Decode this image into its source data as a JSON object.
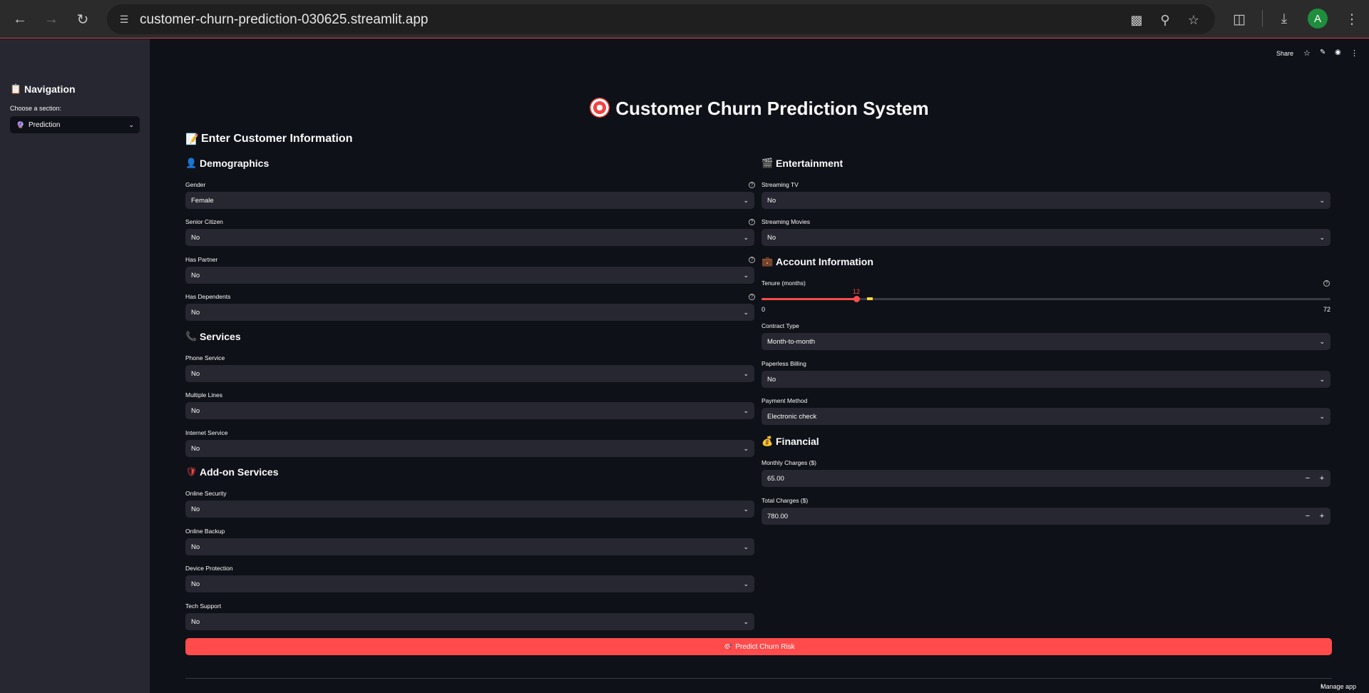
{
  "browser": {
    "url": "customer-churn-prediction-030625.streamlit.app",
    "avatar_letter": "A"
  },
  "toolbar": {
    "share": "Share"
  },
  "sidebar": {
    "title": "Navigation",
    "choose_label": "Choose a section:",
    "selected_section": "Prediction"
  },
  "page": {
    "title": "Customer Churn Prediction System",
    "enter_info": "Enter Customer Information"
  },
  "demographics": {
    "heading": "Demographics",
    "gender_label": "Gender",
    "gender_value": "Female",
    "senior_label": "Senior Citizen",
    "senior_value": "No",
    "partner_label": "Has Partner",
    "partner_value": "No",
    "dependents_label": "Has Dependents",
    "dependents_value": "No"
  },
  "services": {
    "heading": "Services",
    "phone_label": "Phone Service",
    "phone_value": "No",
    "multiple_label": "Multiple Lines",
    "multiple_value": "No",
    "internet_label": "Internet Service",
    "internet_value": "No"
  },
  "addons": {
    "heading": "Add-on Services",
    "security_label": "Online Security",
    "security_value": "No",
    "backup_label": "Online Backup",
    "backup_value": "No",
    "device_label": "Device Protection",
    "device_value": "No",
    "tech_label": "Tech Support",
    "tech_value": "No"
  },
  "entertainment": {
    "heading": "Entertainment",
    "tv_label": "Streaming TV",
    "tv_value": "No",
    "movies_label": "Streaming Movies",
    "movies_value": "No"
  },
  "account": {
    "heading": "Account Information",
    "tenure_label": "Tenure (months)",
    "tenure_value": "12",
    "tenure_fraction": 0.1667,
    "tenure_min": "0",
    "tenure_max": "72",
    "contract_label": "Contract Type",
    "contract_value": "Month-to-month",
    "paperless_label": "Paperless Billing",
    "paperless_value": "No",
    "payment_label": "Payment Method",
    "payment_value": "Electronic check"
  },
  "financial": {
    "heading": "Financial",
    "monthly_label": "Monthly Charges ($)",
    "monthly_value": "65.00",
    "total_label": "Total Charges ($)",
    "total_value": "780.00"
  },
  "predict_button": "Predict Churn Risk",
  "footer": {
    "manage_app": "Manage app"
  },
  "colors": {
    "accent": "#ff4b4b",
    "background": "#0e1117",
    "sidebar": "#262730"
  }
}
